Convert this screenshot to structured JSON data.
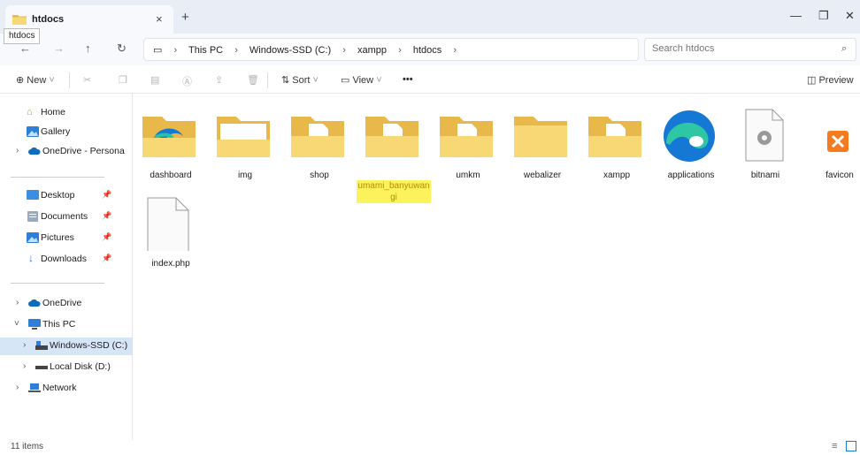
{
  "window": {
    "tab_title": "htdocs",
    "tab_close": "×",
    "new_tab": "+",
    "minimize": "—",
    "maximize": "❐",
    "close": "✕"
  },
  "tooltip": "htdocs",
  "nav": {
    "back": "←",
    "forward": "→",
    "up": "↑",
    "refresh": "↻"
  },
  "breadcrumb": [
    "This PC",
    "Windows-SSD (C:)",
    "xampp",
    "htdocs"
  ],
  "search": {
    "placeholder": "Search htdocs"
  },
  "toolbar": {
    "new_label": "New",
    "sort_label": "Sort",
    "view_label": "View",
    "more_label": "•••",
    "preview_label": "Preview"
  },
  "sidebar": {
    "home": "Home",
    "gallery": "Gallery",
    "onedrive_personal": "OneDrive - Persona",
    "desktop": "Desktop",
    "documents": "Documents",
    "pictures": "Pictures",
    "downloads": "Downloads",
    "onedrive": "OneDrive",
    "this_pc": "This PC",
    "windows_ssd": "Windows-SSD (C:)",
    "local_disk": "Local Disk (D:)",
    "network": "Network"
  },
  "files": [
    {
      "name": "dashboard",
      "kind": "folder-edge"
    },
    {
      "name": "img",
      "kind": "folder-doc"
    },
    {
      "name": "shop",
      "kind": "folder-doc"
    },
    {
      "name": "umami_banyuwangi",
      "kind": "folder-doc",
      "highlight": true
    },
    {
      "name": "umkm",
      "kind": "folder-doc"
    },
    {
      "name": "webalizer",
      "kind": "folder"
    },
    {
      "name": "xampp",
      "kind": "folder-doc"
    },
    {
      "name": "applications",
      "kind": "edge"
    },
    {
      "name": "bitnami",
      "kind": "gear-file"
    },
    {
      "name": "favicon",
      "kind": "xampp-icon"
    },
    {
      "name": "index.php",
      "kind": "file"
    }
  ],
  "status": {
    "item_count": "11 items"
  },
  "colors": {
    "folder_back": "#e8b84b",
    "folder_front": "#f8d775",
    "highlight": "#fcf25c",
    "edge_blue": "#1578d4",
    "xampp_orange": "#f47b20"
  }
}
